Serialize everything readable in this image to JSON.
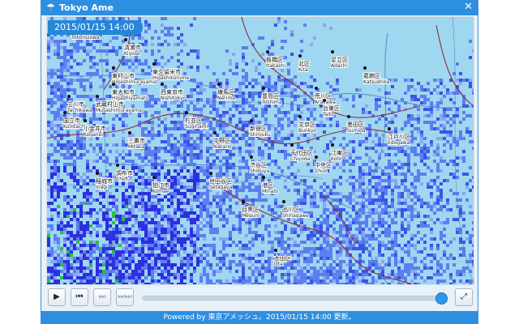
{
  "window": {
    "title": "Tokyo Ame",
    "title_icon": "umbrella-icon",
    "close_icon": "close-icon"
  },
  "map": {
    "timestamp": "2015/01/15 14:00",
    "labels": [
      {
        "name": "所沢市",
        "reading": "Tokorozawa"
      },
      {
        "name": "清瀬市",
        "reading": "Kiyose"
      },
      {
        "name": "東村山市",
        "reading": "Higashimurayama"
      },
      {
        "name": "東大和市",
        "reading": "Higashiyamato"
      },
      {
        "name": "武蔵村山市",
        "reading": "Musashimurayama"
      },
      {
        "name": "立川市",
        "reading": "Tachikawa"
      },
      {
        "name": "国立市",
        "reading": "Kunitachi"
      },
      {
        "name": "小金井市",
        "reading": "Koganei"
      },
      {
        "name": "西東京市",
        "reading": "Nishitokyo"
      },
      {
        "name": "東久留米市",
        "reading": "Higashikurume"
      },
      {
        "name": "三鷹市",
        "reading": "Mitaka"
      },
      {
        "name": "調布市",
        "reading": "Chofu"
      },
      {
        "name": "狛江市",
        "reading": "Komae"
      },
      {
        "name": "稲城市",
        "reading": "Inagi"
      },
      {
        "name": "杉並区",
        "reading": "Suginami"
      },
      {
        "name": "練馬区",
        "reading": "Nerima"
      },
      {
        "name": "板橋区",
        "reading": "Itabashi"
      },
      {
        "name": "北区",
        "reading": "Kita"
      },
      {
        "name": "足立区",
        "reading": "Adachi"
      },
      {
        "name": "葛飾区",
        "reading": "Katsushika"
      },
      {
        "name": "荒川区",
        "reading": "Arakawa"
      },
      {
        "name": "豊島区",
        "reading": "Toshima"
      },
      {
        "name": "文京区",
        "reading": "Bunkyo"
      },
      {
        "name": "台東区",
        "reading": "Taito"
      },
      {
        "name": "墨田区",
        "reading": "Sumida"
      },
      {
        "name": "江戸川区",
        "reading": "Edogawa"
      },
      {
        "name": "新宿区",
        "reading": "Shinjuku"
      },
      {
        "name": "千代田区",
        "reading": "Chiyoda"
      },
      {
        "name": "中央区",
        "reading": "Chuo"
      },
      {
        "name": "江東区",
        "reading": "Koto"
      },
      {
        "name": "渋谷区",
        "reading": "Shibuya"
      },
      {
        "name": "港区",
        "reading": "Minato"
      },
      {
        "name": "世田谷区",
        "reading": "Setagaya"
      },
      {
        "name": "目黒区",
        "reading": "Meguro"
      },
      {
        "name": "品川区",
        "reading": "Shinagawa"
      },
      {
        "name": "大田区",
        "reading": "Ota"
      },
      {
        "name": "中野区",
        "reading": "Nakano"
      }
    ]
  },
  "controls": {
    "play_label": "▶",
    "prev_label": "⏮",
    "next_label": "⏭",
    "last_label": "⏭⏭",
    "fullscreen_label": "⤢",
    "slider_value": 1.0
  },
  "footer": {
    "text": "Powered by 東京アメッシュ。2015/01/15 14:00 更新。"
  }
}
